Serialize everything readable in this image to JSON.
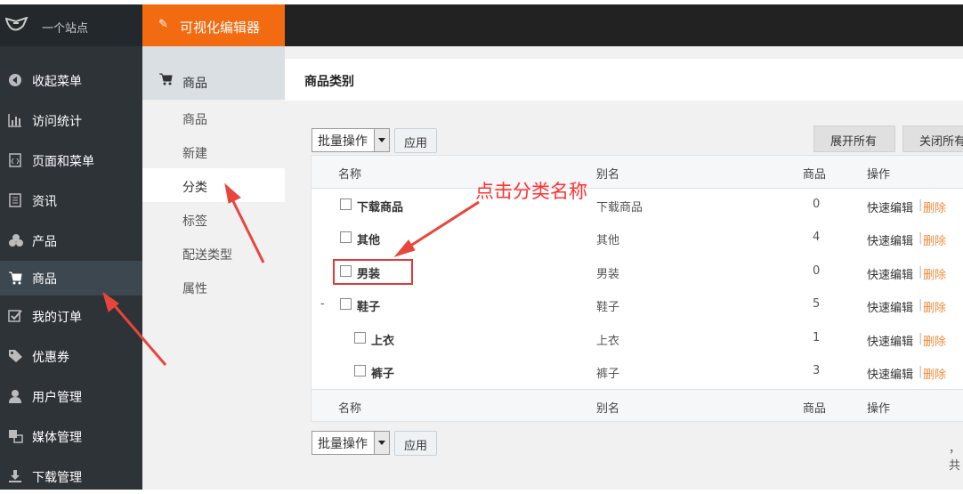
{
  "app": {
    "site_name": "一个站点",
    "editor_label": "可视化编辑器"
  },
  "sidebar": {
    "items": [
      {
        "icon": "collapse-circle-icon",
        "label": "收起菜单"
      },
      {
        "icon": "bar-chart-icon",
        "label": "访问统计"
      },
      {
        "icon": "page-code-icon",
        "label": "页面和菜单"
      },
      {
        "icon": "document-icon",
        "label": "资讯"
      },
      {
        "icon": "cubes-icon",
        "label": "产品"
      },
      {
        "icon": "cart-icon",
        "label": "商品",
        "active": true
      },
      {
        "icon": "checkbox-icon",
        "label": "我的订单"
      },
      {
        "icon": "tag-icon",
        "label": "优惠券"
      },
      {
        "icon": "user-icon",
        "label": "用户管理"
      },
      {
        "icon": "media-icon",
        "label": "媒体管理"
      },
      {
        "icon": "download-icon",
        "label": "下载管理"
      }
    ]
  },
  "submenu": {
    "header": "商品",
    "items": [
      "商品",
      "新建",
      "分类",
      "标签",
      "配送类型",
      "属性"
    ],
    "active": "分类"
  },
  "page": {
    "title": "商品类别",
    "bulk_label": "批量操作",
    "apply_label": "应用",
    "expand_all": "展开所有",
    "close_all": "关闭所有",
    "pager_text": "，共"
  },
  "table": {
    "columns": [
      "名称",
      "别名",
      "商品",
      "操作"
    ],
    "rows": [
      {
        "name": "下载商品",
        "alias": "下载商品",
        "count": "0",
        "level": 0
      },
      {
        "name": "其他",
        "alias": "其他",
        "count": "4",
        "level": 0
      },
      {
        "name": "男装",
        "alias": "男装",
        "count": "0",
        "level": 0
      },
      {
        "name": "鞋子",
        "alias": "鞋子",
        "count": "5",
        "level": 0,
        "collapse": "-"
      },
      {
        "name": "上衣",
        "alias": "上衣",
        "count": "1",
        "level": 1
      },
      {
        "name": "裤子",
        "alias": "裤子",
        "count": "3",
        "level": 1
      }
    ],
    "action_edit": "快速编辑",
    "action_sep": "|",
    "action_delete": "删除"
  },
  "annotation": {
    "text": "点击分类名称",
    "color": "#ff3030"
  },
  "colors": {
    "accent_orange": "#f26b11",
    "sidebar_bg": "#2e3338",
    "delete_link": "#f38a3a"
  }
}
